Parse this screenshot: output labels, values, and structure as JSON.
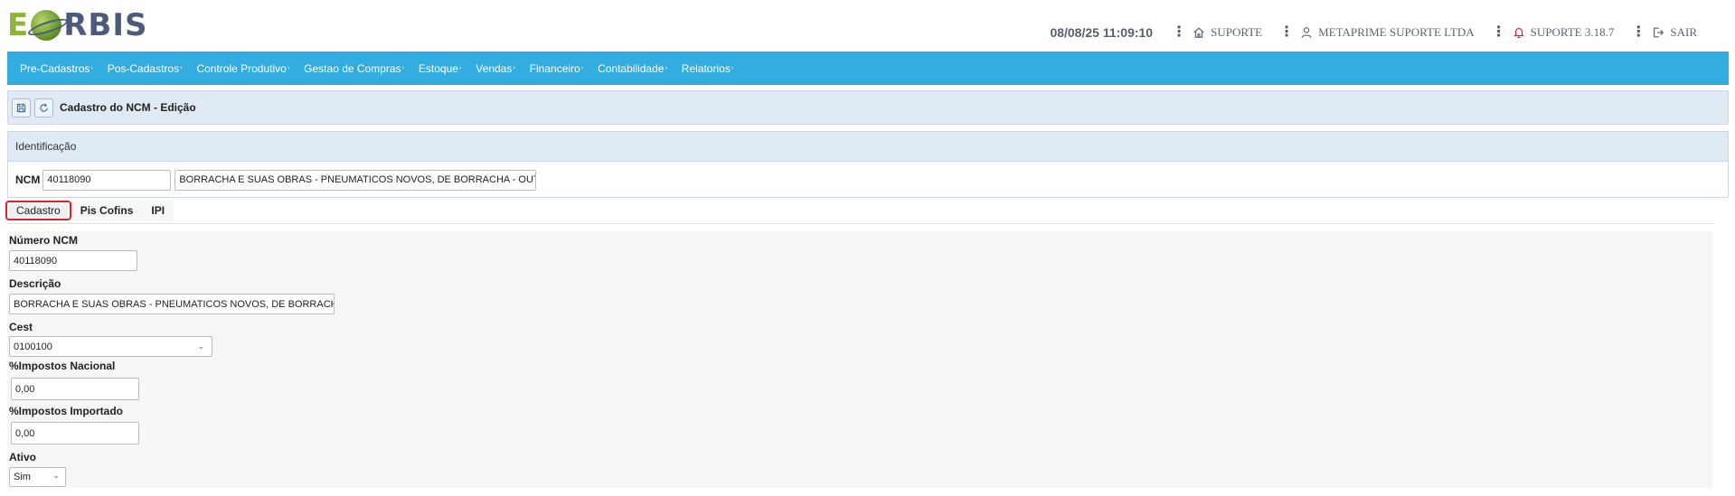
{
  "header": {
    "logo_e": "E",
    "logo_rbis": "RBIS",
    "datetime": "08/08/25 11:09:10",
    "suporte": "SUPORTE",
    "company": "METAPRIME SUPORTE LTDA",
    "version": "SUPORTE 3.18.7",
    "logout": "SAIR",
    "kebab": "⋮"
  },
  "menu": {
    "items": [
      {
        "label": "Pre-Cadastros"
      },
      {
        "label": "Pos-Cadastros"
      },
      {
        "label": "Controle Produtivo"
      },
      {
        "label": "Gestao de Compras"
      },
      {
        "label": "Estoque"
      },
      {
        "label": "Vendas"
      },
      {
        "label": "Financeiro"
      },
      {
        "label": "Contabilidade"
      },
      {
        "label": "Relatorios"
      }
    ],
    "caret": "›"
  },
  "page": {
    "title": "Cadastro do NCM - Edição"
  },
  "identificacao": {
    "heading": "Identificação",
    "ncm_label": "NCM",
    "ncm_value": "40118090",
    "desc_value": "BORRACHA E SUAS OBRAS - PNEUMATICOS NOVOS, DE BORRACHA - OUTR"
  },
  "tabs": [
    {
      "label": "Cadastro"
    },
    {
      "label": "Pis Cofins"
    },
    {
      "label": "IPI"
    }
  ],
  "form": {
    "numero_label": "Número NCM",
    "numero_value": "40118090",
    "descricao_label": "Descrição",
    "descricao_value": "BORRACHA E SUAS OBRAS - PNEUMATICOS NOVOS, DE BORRACHA",
    "cest_label": "Cest",
    "cest_value": "0100100",
    "nac_label": "%Impostos Nacional",
    "nac_value": "0,00",
    "imp_label": "%Impostos Importado",
    "imp_value": "0,00",
    "ativo_label": "Ativo",
    "ativo_value": "Sim",
    "select_caret": "⌄"
  },
  "colors": {
    "menubar": "#33ace0",
    "panel": "#dfeaf5",
    "active_tab_border": "#d8232a",
    "logo_green": "#8ab43c",
    "logo_navy": "#4c5b7c"
  },
  "icons": [
    "home-icon",
    "user-icon",
    "bell-icon",
    "logout-icon",
    "save-icon",
    "refresh-icon"
  ]
}
